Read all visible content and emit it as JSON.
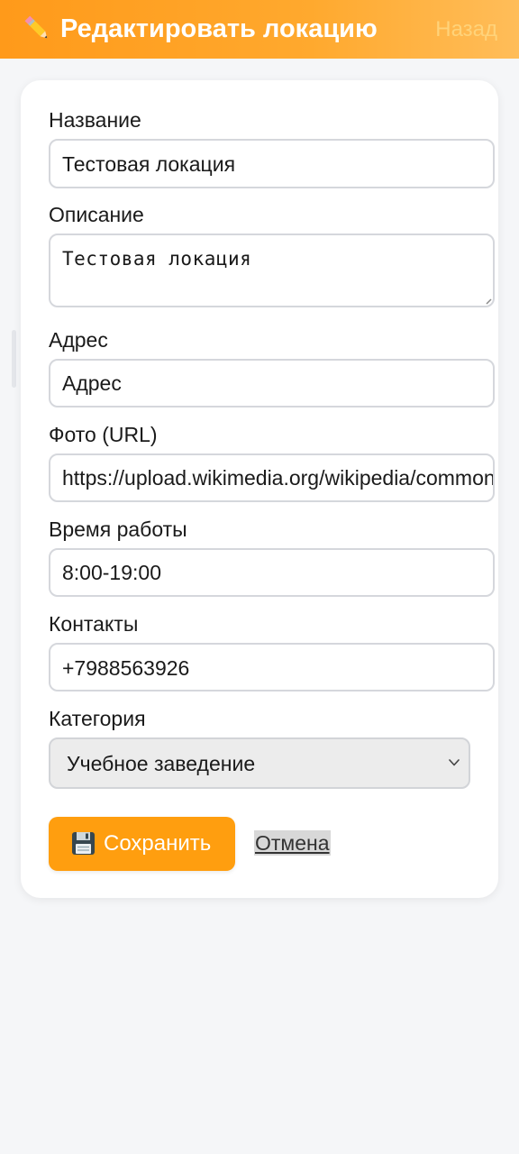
{
  "header": {
    "title": "Редактировать локацию",
    "title_icon": "pencil-icon",
    "back_label": "Назад"
  },
  "form": {
    "name": {
      "label": "Название",
      "value": "Тестовая локация"
    },
    "description": {
      "label": "Описание",
      "value": "Тестовая локация"
    },
    "address": {
      "label": "Адрес",
      "value": "Адрес"
    },
    "photo": {
      "label": "Фото (URL)",
      "value": "https://upload.wikimedia.org/wikipedia/commons/"
    },
    "hours": {
      "label": "Время работы",
      "value": "8:00-19:00"
    },
    "contacts": {
      "label": "Контакты",
      "value": "+7988563926"
    },
    "category": {
      "label": "Категория",
      "selected": "Учебное заведение"
    }
  },
  "actions": {
    "save_label": "Сохранить",
    "save_icon": "floppy-disk-icon",
    "cancel_label": "Отмена"
  },
  "colors": {
    "accent": "#ff9e0f",
    "header_gradient_start": "#ff9a1a",
    "header_gradient_end": "#ffbd59",
    "background": "#f5f6f8"
  }
}
